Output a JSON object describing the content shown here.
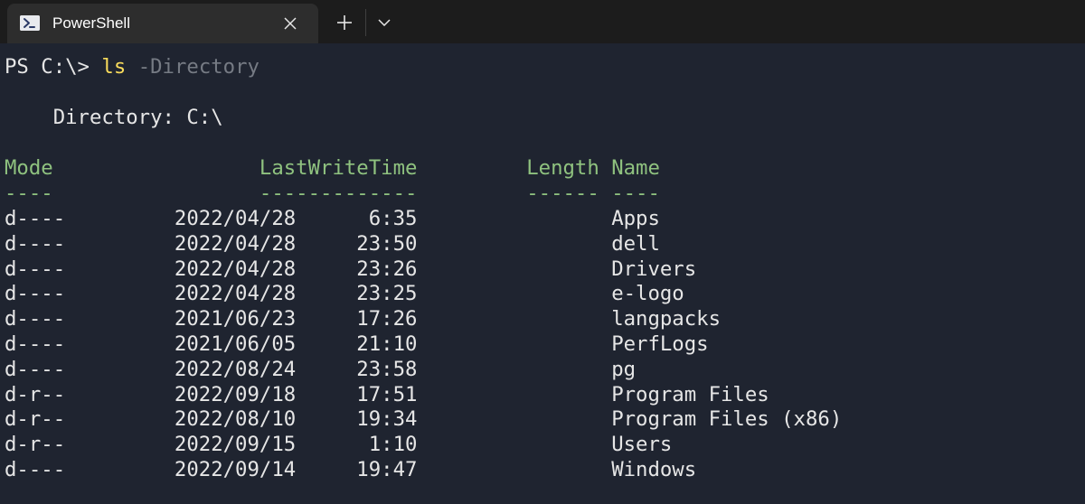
{
  "window": {
    "tab": {
      "title": "PowerShell",
      "icon": "powershell-icon",
      "close_icon": "close-icon"
    },
    "new_tab_icon": "plus-icon",
    "dropdown_icon": "chevron-down-icon"
  },
  "colors": {
    "terminal_background": "#1f2430",
    "titlebar_background": "#1c1c1c",
    "tab_background": "#2d2d2d",
    "text": "#e6e6e6",
    "command": "#f9dc5c",
    "parameter": "#767b84",
    "table_header": "#8fc27f"
  },
  "terminal": {
    "prompt": "PS C:\\> ",
    "command": "ls",
    "argument": "-Directory",
    "directory_line": "    Directory: C:\\",
    "header_line": "Mode                 LastWriteTime         Length Name",
    "underline_line": "----                 -------------         ------ ----",
    "columns": [
      "Mode",
      "LastWriteTime",
      "Length",
      "Name"
    ],
    "rows": [
      {
        "mode": "d----",
        "date": "2022/04/28",
        "time": "6:35",
        "length": "",
        "name": "Apps"
      },
      {
        "mode": "d----",
        "date": "2022/04/28",
        "time": "23:50",
        "length": "",
        "name": "dell"
      },
      {
        "mode": "d----",
        "date": "2022/04/28",
        "time": "23:26",
        "length": "",
        "name": "Drivers"
      },
      {
        "mode": "d----",
        "date": "2022/04/28",
        "time": "23:25",
        "length": "",
        "name": "e-logo"
      },
      {
        "mode": "d----",
        "date": "2021/06/23",
        "time": "17:26",
        "length": "",
        "name": "langpacks"
      },
      {
        "mode": "d----",
        "date": "2021/06/05",
        "time": "21:10",
        "length": "",
        "name": "PerfLogs"
      },
      {
        "mode": "d----",
        "date": "2022/08/24",
        "time": "23:58",
        "length": "",
        "name": "pg"
      },
      {
        "mode": "d-r--",
        "date": "2022/09/18",
        "time": "17:51",
        "length": "",
        "name": "Program Files"
      },
      {
        "mode": "d-r--",
        "date": "2022/08/10",
        "time": "19:34",
        "length": "",
        "name": "Program Files (x86)"
      },
      {
        "mode": "d-r--",
        "date": "2022/09/15",
        "time": "1:10",
        "length": "",
        "name": "Users"
      },
      {
        "mode": "d----",
        "date": "2022/09/14",
        "time": "19:47",
        "length": "",
        "name": "Windows"
      }
    ]
  }
}
